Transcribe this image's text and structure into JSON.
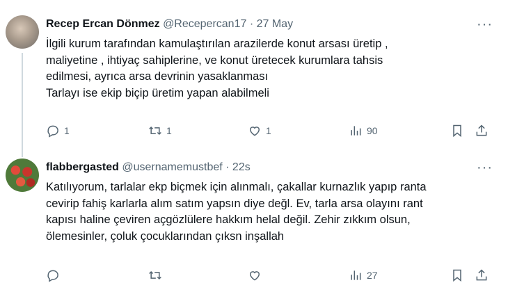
{
  "tweets": [
    {
      "name": "Recep Ercan Dönmez",
      "handle": "@Recepercan17",
      "separator": "·",
      "time": "27 May",
      "more": "···",
      "lines": [
        "İlgili kurum tarafından kamulaştırılan arazilerde konut arsası üretip ,",
        " maliyetine , ihtiyaç sahiplerine, ve konut üretecek kurumlara tahsis",
        " edilmesi, ayrıca arsa devrinin yasaklanması",
        "Tarlayı ise ekip biçip üretim yapan alabilmeli"
      ],
      "replies": "1",
      "reposts": "1",
      "likes": "1",
      "views": "90"
    },
    {
      "name": "flabbergasted",
      "handle": "@usernamemustbef",
      "separator": "·",
      "time": "22s",
      "more": "···",
      "lines": [
        "Katılıyorum, tarlalar ekp biçmek için alınmalı,  çakallar kurnazlık yapıp ranta",
        "cevirip fahiş karlarla alım satım yapsın diye değl. Ev, tarla arsa olayını rant",
        "kapısı haline çeviren açgözlülere hakkım helal değil. Zehir zıkkım olsun,",
        "ölemesinler, çoluk çocuklarından çıksn inşallah"
      ],
      "replies": "",
      "reposts": "",
      "likes": "",
      "views": "27"
    }
  ],
  "icons": [
    "avatar",
    "reply-icon",
    "repost-icon",
    "like-icon",
    "views-icon",
    "bookmark-icon",
    "share-icon",
    "more-icon"
  ]
}
